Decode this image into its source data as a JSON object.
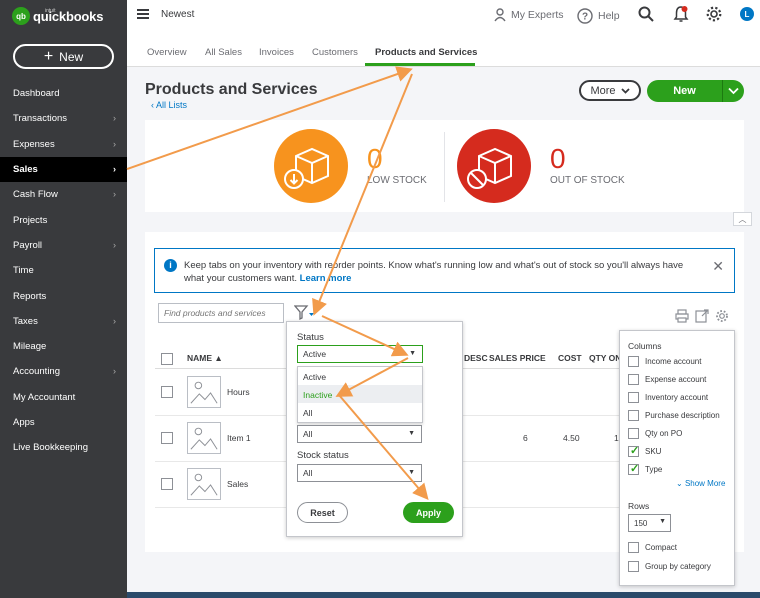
{
  "brand": {
    "intuit": "intuit",
    "name": "quickbooks",
    "badge": "qb"
  },
  "sidebar": {
    "new_label": "New",
    "items": [
      {
        "label": "Dashboard",
        "chevron": false
      },
      {
        "label": "Transactions",
        "chevron": true
      },
      {
        "label": "Expenses",
        "chevron": true
      },
      {
        "label": "Sales",
        "chevron": true,
        "active": true
      },
      {
        "label": "Cash Flow",
        "chevron": true
      },
      {
        "label": "Projects",
        "chevron": false
      },
      {
        "label": "Payroll",
        "chevron": true
      },
      {
        "label": "Time",
        "chevron": false
      },
      {
        "label": "Reports",
        "chevron": false
      },
      {
        "label": "Taxes",
        "chevron": true
      },
      {
        "label": "Mileage",
        "chevron": false
      },
      {
        "label": "Accounting",
        "chevron": true
      },
      {
        "label": "My Accountant",
        "chevron": false
      },
      {
        "label": "Apps",
        "chevron": false
      },
      {
        "label": "Live Bookkeeping",
        "chevron": false
      }
    ]
  },
  "topbar": {
    "company": "Newest",
    "my_experts": "My Experts",
    "help": "Help",
    "avatar": "L"
  },
  "tabs": [
    "Overview",
    "All Sales",
    "Invoices",
    "Customers",
    "Products and Services"
  ],
  "header": {
    "title": "Products and Services",
    "all_lists": "All Lists",
    "more": "More",
    "new": "New"
  },
  "stock": {
    "low_value": "0",
    "low_label": "LOW STOCK",
    "out_value": "0",
    "out_label": "OUT OF STOCK"
  },
  "banner": {
    "text": "Keep tabs on your inventory with reorder points. Know what's running low and what's out of stock so you'll always have what your customers want.",
    "link": "Learn more"
  },
  "search": {
    "placeholder": "Find products and services"
  },
  "table": {
    "headers": {
      "name": "NAME ▲",
      "desc": "DESC",
      "sales_price": "SALES PRICE",
      "cost": "COST",
      "qty": "QTY ON"
    },
    "rows": [
      {
        "name": "Hours",
        "sales_price": "",
        "cost": "",
        "qty": ""
      },
      {
        "name": "Item 1",
        "sales_price": "6",
        "cost": "4.50",
        "qty": "1"
      },
      {
        "name": "Sales",
        "sales_price": "",
        "cost": "",
        "qty": ""
      }
    ]
  },
  "filter": {
    "status_label": "Status",
    "status_value": "Active",
    "status_options": [
      "Active",
      "Inactive",
      "All"
    ],
    "type_value": "All",
    "stock_status_label": "Stock status",
    "stock_status_value": "All",
    "reset": "Reset",
    "apply": "Apply"
  },
  "columns_panel": {
    "title": "Columns",
    "items": [
      {
        "label": "Income account",
        "checked": false
      },
      {
        "label": "Expense account",
        "checked": false
      },
      {
        "label": "Inventory account",
        "checked": false
      },
      {
        "label": "Purchase description",
        "checked": false
      },
      {
        "label": "Qty on PO",
        "checked": false
      },
      {
        "label": "SKU",
        "checked": true
      },
      {
        "label": "Type",
        "checked": true
      }
    ],
    "show_more": "Show More",
    "rows_label": "Rows",
    "rows_value": "150",
    "compact": "Compact",
    "group_by_category": "Group by category"
  },
  "colors": {
    "green": "#2ca01c",
    "orange": "#f7931e",
    "red": "#d52b1e",
    "blue": "#0077c5",
    "sidebar": "#393a3d",
    "arrow": "#f29b4b"
  }
}
